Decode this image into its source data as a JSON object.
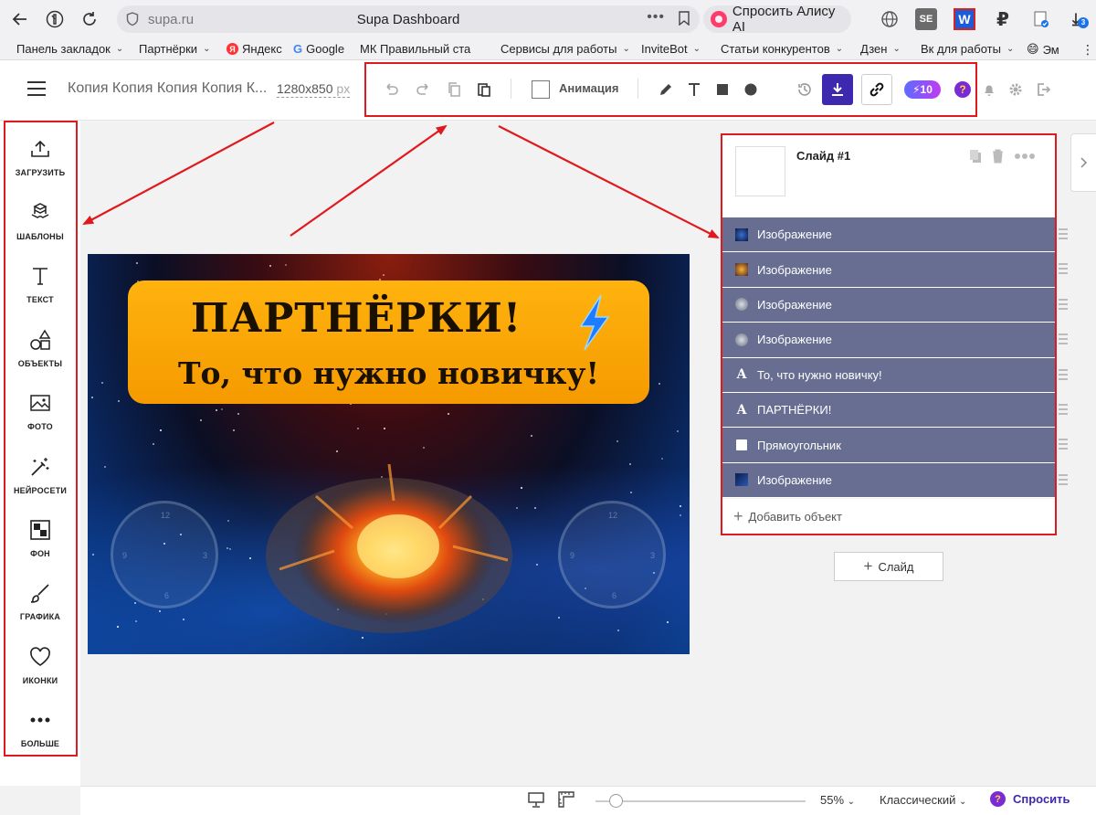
{
  "browser": {
    "domain": "supa.ru",
    "tab_title": "Supa Dashboard",
    "alisa_label": "Спросить Алису AI",
    "bookmarks": [
      {
        "label": "Панель закладок",
        "chevron": true
      },
      {
        "label": "Партнёрки",
        "chevron": true
      },
      {
        "label": "Яндекс",
        "chevron": false
      },
      {
        "label": "Google",
        "chevron": false
      },
      {
        "label": "МК Правильный ста",
        "chevron": true
      },
      {
        "label": "Сервисы для работы",
        "chevron": true
      },
      {
        "label": "InviteBot",
        "chevron": true
      },
      {
        "label": "Статьи конкурентов",
        "chevron": true
      },
      {
        "label": "Дзен",
        "chevron": true
      },
      {
        "label": "Вк для работы",
        "chevron": true
      },
      {
        "label": "Эм",
        "chevron": false
      }
    ],
    "ext_badge": "3"
  },
  "header": {
    "doc_title": "Копия Копия Копия Копия К...",
    "doc_size": "1280x850",
    "doc_size_unit": "px",
    "animation_label": "Анимация",
    "credits": "10",
    "credits_icon": "⚡"
  },
  "sidebar": {
    "items": [
      {
        "label": "ЗАГРУЗИТЬ",
        "icon": "upload-icon"
      },
      {
        "label": "ШАБЛОНЫ",
        "icon": "templates-icon"
      },
      {
        "label": "ТЕКСТ",
        "icon": "text-icon"
      },
      {
        "label": "ОБЪЕКТЫ",
        "icon": "objects-icon"
      },
      {
        "label": "ФОТО",
        "icon": "photo-icon"
      },
      {
        "label": "НЕЙРОСЕТИ",
        "icon": "magic-wand-icon"
      },
      {
        "label": "ФОН",
        "icon": "background-icon"
      },
      {
        "label": "ГРАФИКА",
        "icon": "brush-icon"
      },
      {
        "label": "ИКОНКИ",
        "icon": "heart-icon"
      },
      {
        "label": "БОЛЬШЕ",
        "icon": "more-icon"
      }
    ]
  },
  "canvas": {
    "headline": "ПАРТНЁРКИ!",
    "subline": "То, что нужно новичку!"
  },
  "slide_panel": {
    "slide_name": "Слайд #1",
    "layers": [
      {
        "label": "Изображение",
        "type": "image"
      },
      {
        "label": "Изображение",
        "type": "image"
      },
      {
        "label": "Изображение",
        "type": "image"
      },
      {
        "label": "Изображение",
        "type": "image"
      },
      {
        "label": "То, что нужно новичку!",
        "type": "text"
      },
      {
        "label": "ПАРТНЁРКИ!",
        "type": "text"
      },
      {
        "label": "Прямоугольник",
        "type": "rect"
      },
      {
        "label": "Изображение",
        "type": "image"
      }
    ],
    "add_object_label": "Добавить объект",
    "add_slide_label": "Слайд"
  },
  "footer": {
    "zoom": "55%",
    "mode": "Классический",
    "ask_label": "Спросить"
  },
  "colors": {
    "accent": "#3c29b0",
    "layer_bg": "#686e91",
    "annotation_red": "#e0191e",
    "banner_orange": "#ffa70a"
  }
}
